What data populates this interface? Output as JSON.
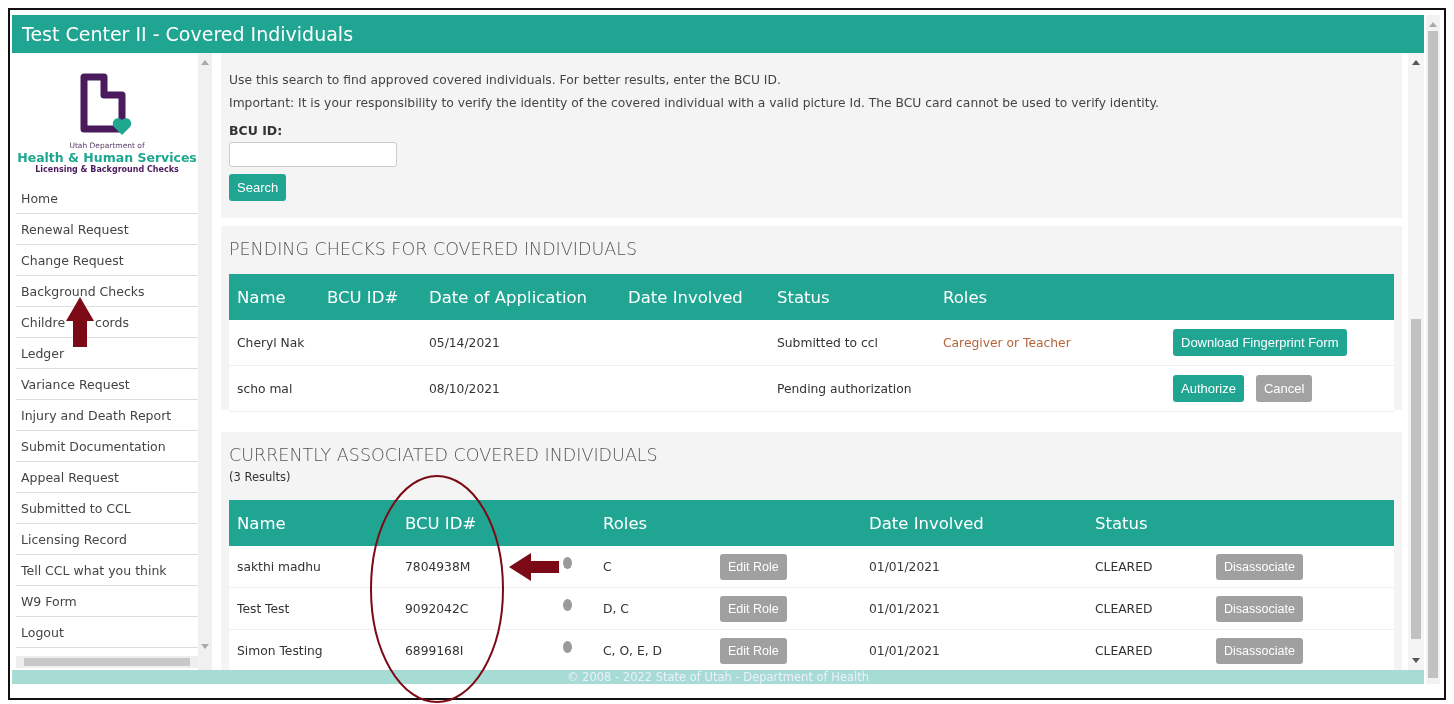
{
  "window": {
    "title": "Test Center II - Covered Individuals"
  },
  "logo": {
    "line1": "Utah Department of",
    "line2": "Health & Human Services",
    "line3": "Licensing & Background Checks"
  },
  "sidebar": {
    "items": [
      {
        "label": "Home"
      },
      {
        "label": "Renewal Request"
      },
      {
        "label": "Change Request"
      },
      {
        "label": "Background Checks"
      },
      {
        "label": "Childre",
        "label_tail": "cords"
      },
      {
        "label": "Ledger"
      },
      {
        "label": "Variance Request"
      },
      {
        "label": "Injury and Death Report"
      },
      {
        "label": "Submit Documentation"
      },
      {
        "label": "Appeal Request"
      },
      {
        "label": "Submitted to CCL"
      },
      {
        "label": "Licensing Record"
      },
      {
        "label": "Tell CCL what you think"
      },
      {
        "label": "W9 Form"
      },
      {
        "label": "Logout"
      }
    ]
  },
  "search": {
    "description": "Use this search to find approved covered individuals. For better results, enter the BCU ID.",
    "notice": "Important: It is your responsibility to verify the identity of the covered individual with a valid picture Id. The BCU card cannot be used to verify identity.",
    "field_label": "BCU ID:",
    "button": "Search"
  },
  "pending": {
    "title": "PENDING CHECKS FOR COVERED INDIVIDUALS",
    "columns": [
      "Name",
      "BCU ID#",
      "Date of Application",
      "Date Involved",
      "Status",
      "Roles"
    ],
    "rows": [
      {
        "name": "Cheryl Nak",
        "date_of_application": "05/14/2021",
        "status": "Submitted to ccl",
        "roles": "Caregiver or Teacher",
        "actions": [
          {
            "label": "Download Fingerprint Form",
            "kind": "primary"
          }
        ]
      },
      {
        "name": "scho mal",
        "date_of_application": "08/10/2021",
        "status": "Pending authorization",
        "actions": [
          {
            "label": "Authorize",
            "kind": "primary"
          },
          {
            "label": "Cancel",
            "kind": "secondary"
          }
        ]
      }
    ]
  },
  "current": {
    "title": "CURRENTLY ASSOCIATED COVERED INDIVIDUALS",
    "count": "(3 Results)",
    "columns": [
      "Name",
      "BCU ID#",
      "Roles",
      "Date Involved",
      "Status"
    ],
    "rows": [
      {
        "name": "sakthi madhu",
        "bcu_id": "7804938M",
        "roles": "C",
        "edit": "Edit Role",
        "date_involved": "01/01/2021",
        "status": "CLEARED",
        "action": "Disassociate"
      },
      {
        "name": "Test Test",
        "bcu_id": "9092042C",
        "roles": "D, C",
        "edit": "Edit Role",
        "date_involved": "01/01/2021",
        "status": "CLEARED",
        "action": "Disassociate"
      },
      {
        "name": "Simon Testing",
        "bcu_id": "6899168I",
        "roles": "C, O, E, D",
        "edit": "Edit Role",
        "date_involved": "01/01/2021",
        "status": "CLEARED",
        "action": "Disassociate"
      }
    ]
  },
  "footer": "© 2008 - 2022 State of Utah - Department of Health"
}
